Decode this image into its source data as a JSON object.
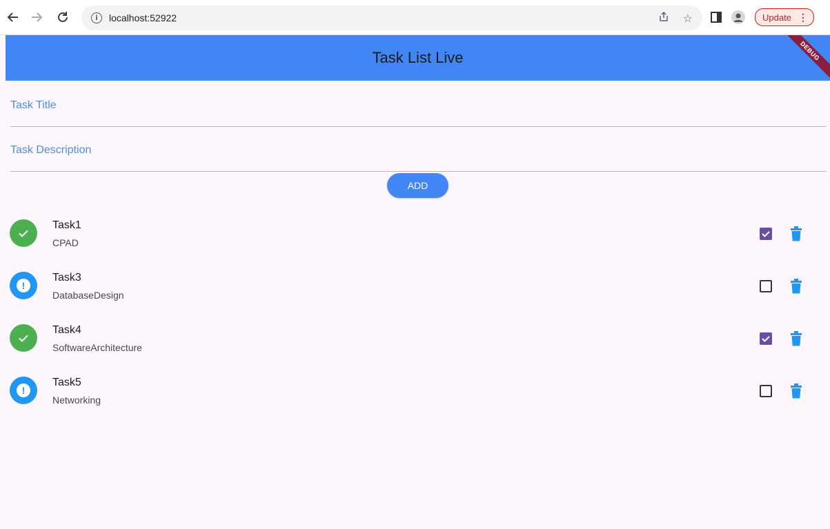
{
  "browser": {
    "url": "localhost:52922",
    "update_label": "Update"
  },
  "app": {
    "title": "Task List Live",
    "debug_label": "DEBUG",
    "accent_color": "#4285f4"
  },
  "form": {
    "title_label": "Task Title",
    "description_label": "Task Description",
    "add_label": "ADD"
  },
  "tasks": [
    {
      "title": "Task1",
      "description": "CPAD",
      "done": true
    },
    {
      "title": "Task3",
      "description": "DatabaseDesign",
      "done": false
    },
    {
      "title": "Task4",
      "description": "SoftwareArchitecture",
      "done": true
    },
    {
      "title": "Task5",
      "description": "Networking",
      "done": false
    }
  ],
  "icons": {
    "done": "check-circle-icon",
    "pending": "exclamation-circle-icon",
    "delete": "trash-icon"
  }
}
